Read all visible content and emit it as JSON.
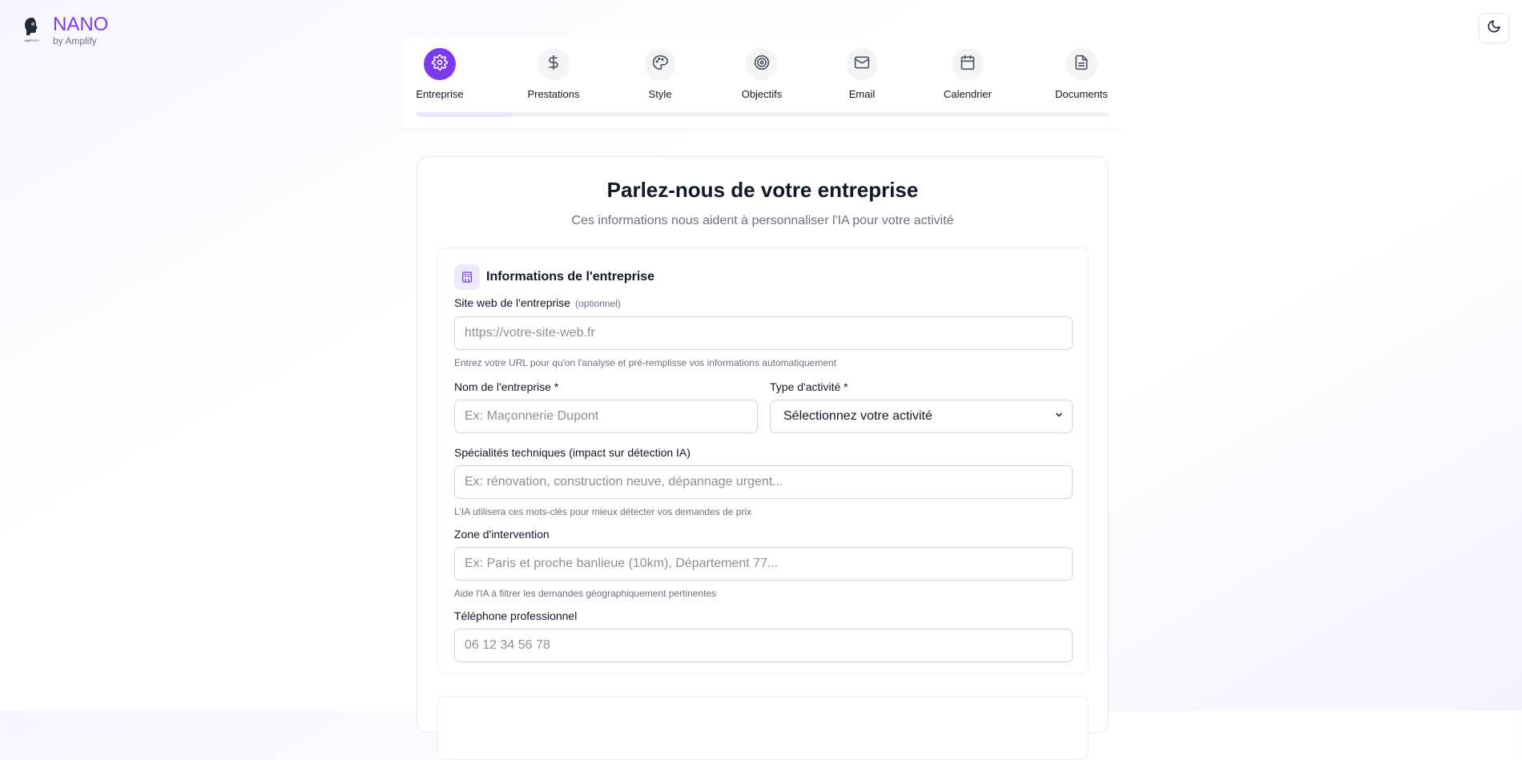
{
  "brand": {
    "logo_text": "AMPLIFY",
    "name": "NANO",
    "subtitle": "by Amplify"
  },
  "theme_toggle": {
    "icon": "moon-icon"
  },
  "steps": [
    {
      "label": "Entreprise",
      "icon": "gear-icon",
      "active": true
    },
    {
      "label": "Prestations",
      "icon": "dollar-icon",
      "active": false
    },
    {
      "label": "Style",
      "icon": "palette-icon",
      "active": false
    },
    {
      "label": "Objectifs",
      "icon": "target-icon",
      "active": false
    },
    {
      "label": "Email",
      "icon": "mail-icon",
      "active": false
    },
    {
      "label": "Calendrier",
      "icon": "calendar-icon",
      "active": false
    },
    {
      "label": "Documents",
      "icon": "document-icon",
      "active": false
    }
  ],
  "progress": {
    "fraction": 0.14
  },
  "card": {
    "title": "Parlez-nous de votre entreprise",
    "subtitle": "Ces informations nous aident à personnaliser l'IA pour votre activité"
  },
  "section": {
    "icon": "building-icon",
    "title": "Informations de l'entreprise",
    "website": {
      "label": "Site web de l'entreprise",
      "optional": "(optionnel)",
      "placeholder": "https://votre-site-web.fr",
      "value": "",
      "hint": "Entrez votre URL pour qu'on l'analyse et pré-remplisse vos informations automatiquement"
    },
    "company_name": {
      "label": "Nom de l'entreprise *",
      "placeholder": "Ex: Maçonnerie Dupont",
      "value": ""
    },
    "activity_type": {
      "label": "Type d'activité *",
      "selected": "Sélectionnez votre activité"
    },
    "specialties": {
      "label": "Spécialités techniques (impact sur détection IA)",
      "placeholder": "Ex: rénovation, construction neuve, dépannage urgent...",
      "value": "",
      "hint": "L'IA utilisera ces mots-clés pour mieux détecter vos demandes de prix"
    },
    "zone": {
      "label": "Zone d'intervention",
      "placeholder": "Ex: Paris et proche banlieue (10km), Département 77...",
      "value": "",
      "hint": "Aide l'IA à filtrer les demandes géographiquement pertinentes"
    },
    "phone": {
      "label": "Téléphone professionnel",
      "placeholder": "06 12 34 56 78",
      "value": ""
    }
  },
  "colors": {
    "accent": "#7c3aed",
    "accent_soft": "#ede9fe",
    "muted": "#6b7280"
  }
}
